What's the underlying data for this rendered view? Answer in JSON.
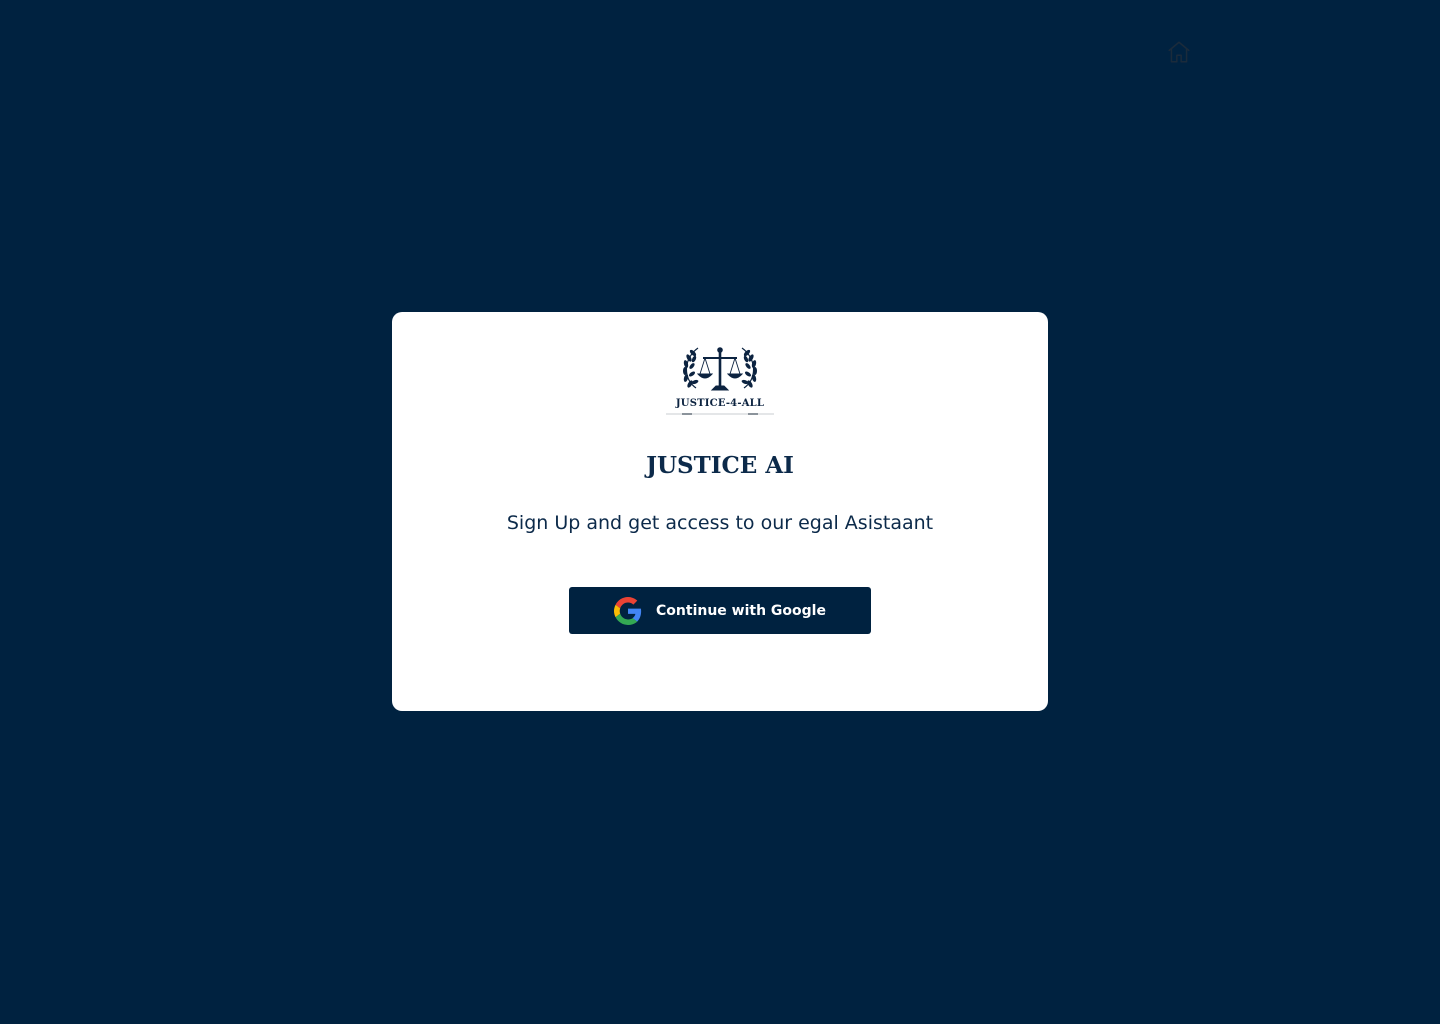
{
  "header": {
    "home_icon": "home-icon"
  },
  "card": {
    "logo_text": "JUSTICE-4-ALL",
    "logo_icon": "scales-of-justice-laurel-icon",
    "title": "JUSTICE AI",
    "subtitle": "Sign Up and get access to our egal Asistaant",
    "google_button": {
      "label": "Continue with Google",
      "icon": "google-icon"
    }
  },
  "colors": {
    "background": "#002240",
    "card": "#ffffff",
    "text": "#0c2a4a",
    "button": "#002240"
  }
}
